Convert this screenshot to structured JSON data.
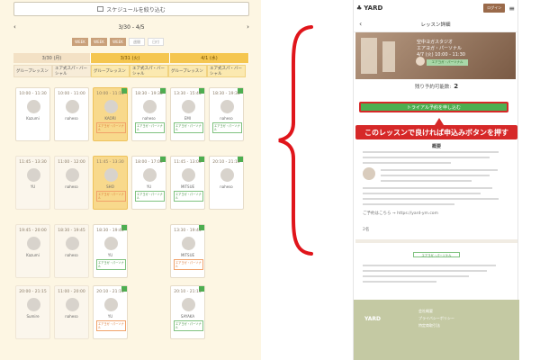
{
  "schedule": {
    "filter_label": "スケジュールを絞り込む",
    "week_label": "3/30 - 4/5",
    "prev_arrow": "‹",
    "next_arrow": "›",
    "view_tabs": [
      "WEEK",
      "WEEK",
      "WEEK",
      "週間",
      "日付"
    ],
    "days": [
      "3/30 (月)",
      "3/31 (火)",
      "4/1 (水)"
    ],
    "categories": [
      "グループレッスン",
      "エア式スパ・バーシャル",
      "グループレッスン",
      "エア式スパ・バーシャル",
      "グループレッスン",
      "エア式スパ・バーシャル"
    ],
    "cards": [
      {
        "time": "10:00 - 11:30",
        "name": "Kazumi",
        "tag": "エアヨガ・パーソナル"
      },
      {
        "time": "10:00 - 11:00",
        "name": "naheso",
        "tag": "エアヨガ・パーソナル"
      },
      {
        "time": "10:00 - 11:15",
        "name": "KAORI",
        "tag": "エアヨガ・パーソナル"
      },
      {
        "time": "18:30 - 19:30",
        "name": "naheso",
        "tag": "エアヨガ・パーソナル"
      },
      {
        "time": "13:30 - 15:45",
        "name": "EMI",
        "tag": "エアヨガ・パーソナル"
      },
      {
        "time": "18:30 - 19:30",
        "name": "naheso",
        "tag": "エアヨガ・パーソナル"
      },
      {
        "time": "11:45 - 13:30",
        "name": "YU",
        "tag": "エアヨガ・パーソナル"
      },
      {
        "time": "11:00 - 12:00",
        "name": "naheso",
        "tag": "エアヨガ・パーソナル"
      },
      {
        "time": "11:45 - 13:30",
        "name": "SHO",
        "tag": "エアヨガ・パーソナル"
      },
      {
        "time": "18:00 - 17:00",
        "name": "YU",
        "tag": "エアヨガ・パーソナル"
      },
      {
        "time": "11:45 - 13:00",
        "name": "MITSUE",
        "tag": "エアヨガ・パーソナル"
      },
      {
        "time": "20:10 - 21:10",
        "name": "naheso",
        "tag": "エアヨガ・パーソナル"
      },
      {
        "time": "19:45 - 20:00",
        "name": "Kazumi",
        "tag": "エアヨガ・パーソナル"
      },
      {
        "time": "18:30 - 19:45",
        "name": "naheso",
        "tag": "エアヨガ・パーソナル"
      },
      {
        "time": "18:30 - 19:45",
        "name": "YU",
        "tag": "エアヨガ・パーソナル"
      },
      {
        "time": "13:30 - 19:45",
        "name": "MITSUE",
        "tag": "エアヨガ・パーソナル"
      },
      {
        "time": "20:00 - 21:15",
        "name": "Sumire",
        "tag": "エアヨガ・パーソナル"
      },
      {
        "time": "11:00 - 20:00",
        "name": "naheso",
        "tag": "エアヨガ・パーソナル"
      },
      {
        "time": "20:10 - 21:15",
        "name": "YU",
        "tag": "エアヨガ・パーソナル"
      },
      {
        "time": "20:10 - 21:15",
        "name": "SAYAKA",
        "tag": "エアヨガ・パーソナル"
      }
    ]
  },
  "phone": {
    "logo": "YARD",
    "login_label": "ログイン",
    "menu_icon": "≡",
    "title": "レッスン詳細",
    "back_icon": "‹",
    "hero_line1": "空中ヨガスタジオ",
    "hero_line2": "エアヨガ・パーソナル",
    "hero_line3": "4/7 (火) 10:00 - 11:30",
    "hero_badge": "エアヨガ・パーソナル",
    "remaining_label": "残り予約可能数:",
    "remaining_count": "2",
    "apply_label": "トライアル予約を申し込む",
    "callout": "このレッスンで良ければ申込みボタンを押す",
    "section_title": "概要",
    "small_text_1": "ご予約はこちら → https://yard-ym.com",
    "count_small": "2名",
    "pill": "エアヨガ・パーソナル",
    "footer_logo": "YARD",
    "footer_links": [
      "会社概要",
      "プライバシーポリシー",
      "特定商取引法"
    ]
  }
}
